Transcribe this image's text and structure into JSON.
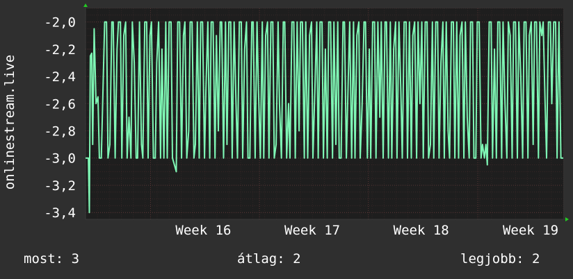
{
  "chart_data": {
    "type": "line",
    "ylabel": "onlinestream.live",
    "xlabel": "",
    "title": "",
    "ylim": [
      -3.45,
      -1.9
    ],
    "yticks": [
      -2.0,
      -2.2,
      -2.4,
      -2.6,
      -2.8,
      -3.0,
      -3.2,
      -3.4
    ],
    "ytick_labels": [
      "-2,0",
      "-2,2",
      "-2,4",
      "-2,6",
      "-2,8",
      "-3,0",
      "-3,2",
      "-3,4"
    ],
    "xlim": [
      0,
      1
    ],
    "xtick_labels": [
      "Week 16",
      "Week 17",
      "Week 18",
      "Week 19"
    ],
    "xticks": [
      0.136,
      0.364,
      0.592,
      0.821
    ],
    "grid": true,
    "colors": {
      "background": "#2f2f2f",
      "plot_background": "#1e1e1e",
      "grid": "#5a3636",
      "line": "#7ff7b5",
      "arrow": "#22cc22"
    },
    "series": [
      {
        "values": [
          [
            0.0,
            -3.0
          ],
          [
            0.006,
            -3.0
          ],
          [
            0.008,
            -3.4
          ],
          [
            0.01,
            -2.25
          ],
          [
            0.013,
            -2.23
          ],
          [
            0.015,
            -2.9
          ],
          [
            0.018,
            -2.05
          ],
          [
            0.022,
            -2.6
          ],
          [
            0.026,
            -2.55
          ],
          [
            0.029,
            -3.0
          ],
          [
            0.033,
            -3.0
          ],
          [
            0.04,
            -2.0
          ],
          [
            0.044,
            -2.0
          ],
          [
            0.047,
            -3.0
          ],
          [
            0.051,
            -2.9
          ],
          [
            0.055,
            -2.0
          ],
          [
            0.058,
            -2.0
          ],
          [
            0.062,
            -3.0
          ],
          [
            0.066,
            -2.2
          ],
          [
            0.069,
            -2.0
          ],
          [
            0.073,
            -2.0
          ],
          [
            0.076,
            -3.0
          ],
          [
            0.08,
            -2.1
          ],
          [
            0.084,
            -2.0
          ],
          [
            0.087,
            -3.0
          ],
          [
            0.091,
            -2.7
          ],
          [
            0.095,
            -3.0
          ],
          [
            0.098,
            -2.0
          ],
          [
            0.102,
            -2.3
          ],
          [
            0.106,
            -3.0
          ],
          [
            0.109,
            -3.0
          ],
          [
            0.113,
            -2.0
          ],
          [
            0.117,
            -2.9
          ],
          [
            0.12,
            -3.0
          ],
          [
            0.124,
            -2.0
          ],
          [
            0.128,
            -2.0
          ],
          [
            0.131,
            -3.0
          ],
          [
            0.135,
            -2.1
          ],
          [
            0.138,
            -2.0
          ],
          [
            0.142,
            -3.0
          ],
          [
            0.146,
            -3.0
          ],
          [
            0.149,
            -2.3
          ],
          [
            0.153,
            -2.0
          ],
          [
            0.157,
            -3.0
          ],
          [
            0.16,
            -2.2
          ],
          [
            0.164,
            -3.0
          ],
          [
            0.168,
            -2.0
          ],
          [
            0.171,
            -3.0
          ],
          [
            0.175,
            -2.0
          ],
          [
            0.179,
            -2.0
          ],
          [
            0.182,
            -3.0
          ],
          [
            0.186,
            -3.05
          ],
          [
            0.19,
            -3.1
          ],
          [
            0.193,
            -2.0
          ],
          [
            0.197,
            -2.0
          ],
          [
            0.201,
            -3.0
          ],
          [
            0.205,
            -2.1
          ],
          [
            0.208,
            -2.0
          ],
          [
            0.212,
            -3.0
          ],
          [
            0.216,
            -2.8
          ],
          [
            0.219,
            -2.0
          ],
          [
            0.223,
            -2.0
          ],
          [
            0.227,
            -3.0
          ],
          [
            0.23,
            -2.9
          ],
          [
            0.234,
            -2.0
          ],
          [
            0.238,
            -3.0
          ],
          [
            0.241,
            -2.0
          ],
          [
            0.245,
            -2.0
          ],
          [
            0.249,
            -3.0
          ],
          [
            0.252,
            -2.5
          ],
          [
            0.256,
            -2.0
          ],
          [
            0.26,
            -3.0
          ],
          [
            0.263,
            -2.0
          ],
          [
            0.267,
            -2.0
          ],
          [
            0.271,
            -3.0
          ],
          [
            0.274,
            -2.1
          ],
          [
            0.278,
            -2.8
          ],
          [
            0.282,
            -2.0
          ],
          [
            0.285,
            -2.0
          ],
          [
            0.289,
            -3.0
          ],
          [
            0.293,
            -2.0
          ],
          [
            0.296,
            -2.9
          ],
          [
            0.3,
            -2.0
          ],
          [
            0.304,
            -2.0
          ],
          [
            0.307,
            -3.0
          ],
          [
            0.311,
            -2.0
          ],
          [
            0.315,
            -2.6
          ],
          [
            0.318,
            -3.0
          ],
          [
            0.322,
            -2.0
          ],
          [
            0.326,
            -2.0
          ],
          [
            0.329,
            -3.0
          ],
          [
            0.333,
            -2.2
          ],
          [
            0.337,
            -2.0
          ],
          [
            0.34,
            -3.0
          ],
          [
            0.344,
            -3.0
          ],
          [
            0.348,
            -2.0
          ],
          [
            0.351,
            -2.0
          ],
          [
            0.355,
            -3.0
          ],
          [
            0.359,
            -2.0
          ],
          [
            0.362,
            -2.5
          ],
          [
            0.366,
            -3.0
          ],
          [
            0.37,
            -2.0
          ],
          [
            0.373,
            -3.0
          ],
          [
            0.377,
            -2.1
          ],
          [
            0.381,
            -2.0
          ],
          [
            0.384,
            -3.0
          ],
          [
            0.388,
            -2.0
          ],
          [
            0.392,
            -2.0
          ],
          [
            0.395,
            -3.0
          ],
          [
            0.399,
            -2.9
          ],
          [
            0.403,
            -2.0
          ],
          [
            0.406,
            -2.6
          ],
          [
            0.41,
            -3.0
          ],
          [
            0.414,
            -2.0
          ],
          [
            0.417,
            -2.0
          ],
          [
            0.421,
            -3.0
          ],
          [
            0.425,
            -2.6
          ],
          [
            0.428,
            -3.0
          ],
          [
            0.432,
            -2.0
          ],
          [
            0.436,
            -2.0
          ],
          [
            0.439,
            -3.0
          ],
          [
            0.443,
            -2.0
          ],
          [
            0.447,
            -2.8
          ],
          [
            0.45,
            -2.0
          ],
          [
            0.454,
            -2.0
          ],
          [
            0.458,
            -3.0
          ],
          [
            0.461,
            -2.0
          ],
          [
            0.465,
            -3.0
          ],
          [
            0.469,
            -2.1
          ],
          [
            0.473,
            -2.0
          ],
          [
            0.476,
            -3.0
          ],
          [
            0.48,
            -2.5
          ],
          [
            0.484,
            -2.0
          ],
          [
            0.487,
            -3.0
          ],
          [
            0.491,
            -2.0
          ],
          [
            0.495,
            -2.0
          ],
          [
            0.498,
            -3.0
          ],
          [
            0.502,
            -2.2
          ],
          [
            0.506,
            -3.0
          ],
          [
            0.509,
            -2.0
          ],
          [
            0.513,
            -2.0
          ],
          [
            0.517,
            -3.0
          ],
          [
            0.52,
            -2.0
          ],
          [
            0.524,
            -2.9
          ],
          [
            0.528,
            -2.0
          ],
          [
            0.531,
            -3.0
          ],
          [
            0.535,
            -3.0
          ],
          [
            0.539,
            -2.0
          ],
          [
            0.542,
            -2.0
          ],
          [
            0.546,
            -3.0
          ],
          [
            0.55,
            -2.4
          ],
          [
            0.553,
            -2.0
          ],
          [
            0.557,
            -3.0
          ],
          [
            0.561,
            -2.0
          ],
          [
            0.564,
            -3.0
          ],
          [
            0.568,
            -2.1
          ],
          [
            0.572,
            -2.0
          ],
          [
            0.575,
            -3.0
          ],
          [
            0.579,
            -2.6
          ],
          [
            0.583,
            -2.0
          ],
          [
            0.586,
            -2.0
          ],
          [
            0.59,
            -3.0
          ],
          [
            0.594,
            -2.2
          ],
          [
            0.597,
            -3.0
          ],
          [
            0.601,
            -2.0
          ],
          [
            0.605,
            -2.0
          ],
          [
            0.608,
            -3.0
          ],
          [
            0.612,
            -2.0
          ],
          [
            0.616,
            -2.7
          ],
          [
            0.619,
            -2.0
          ],
          [
            0.623,
            -3.0
          ],
          [
            0.627,
            -2.0
          ],
          [
            0.63,
            -2.0
          ],
          [
            0.634,
            -3.0
          ],
          [
            0.638,
            -2.0
          ],
          [
            0.641,
            -3.0
          ],
          [
            0.645,
            -2.2
          ],
          [
            0.649,
            -2.0
          ],
          [
            0.652,
            -3.0
          ],
          [
            0.656,
            -2.0
          ],
          [
            0.66,
            -2.5
          ],
          [
            0.663,
            -3.0
          ],
          [
            0.667,
            -2.0
          ],
          [
            0.671,
            -2.0
          ],
          [
            0.674,
            -3.0
          ],
          [
            0.678,
            -2.0
          ],
          [
            0.682,
            -3.0
          ],
          [
            0.685,
            -2.1
          ],
          [
            0.689,
            -2.0
          ],
          [
            0.693,
            -3.0
          ],
          [
            0.696,
            -2.0
          ],
          [
            0.7,
            -2.6
          ],
          [
            0.704,
            -2.0
          ],
          [
            0.707,
            -3.0
          ],
          [
            0.711,
            -2.0
          ],
          [
            0.715,
            -2.0
          ],
          [
            0.718,
            -3.0
          ],
          [
            0.722,
            -2.9
          ],
          [
            0.726,
            -2.0
          ],
          [
            0.729,
            -3.0
          ],
          [
            0.733,
            -2.0
          ],
          [
            0.737,
            -2.0
          ],
          [
            0.74,
            -3.0
          ],
          [
            0.744,
            -2.3
          ],
          [
            0.748,
            -2.0
          ],
          [
            0.751,
            -3.0
          ],
          [
            0.755,
            -2.0
          ],
          [
            0.759,
            -2.8
          ],
          [
            0.762,
            -3.0
          ],
          [
            0.766,
            -2.0
          ],
          [
            0.77,
            -2.0
          ],
          [
            0.773,
            -3.0
          ],
          [
            0.777,
            -2.0
          ],
          [
            0.781,
            -3.0
          ],
          [
            0.784,
            -2.1
          ],
          [
            0.788,
            -2.0
          ],
          [
            0.792,
            -3.0
          ],
          [
            0.795,
            -2.0
          ],
          [
            0.799,
            -2.7
          ],
          [
            0.803,
            -3.0
          ],
          [
            0.806,
            -2.0
          ],
          [
            0.81,
            -2.0
          ],
          [
            0.813,
            -3.0
          ],
          [
            0.817,
            -3.0
          ],
          [
            0.82,
            -2.0
          ],
          [
            0.824,
            -2.0
          ],
          [
            0.828,
            -3.0
          ],
          [
            0.831,
            -2.9
          ],
          [
            0.835,
            -3.0
          ],
          [
            0.838,
            -2.9
          ],
          [
            0.841,
            -3.05
          ],
          [
            0.845,
            -2.0
          ],
          [
            0.849,
            -2.0
          ],
          [
            0.852,
            -3.0
          ],
          [
            0.856,
            -2.2
          ],
          [
            0.86,
            -3.0
          ],
          [
            0.863,
            -2.0
          ],
          [
            0.867,
            -2.0
          ],
          [
            0.871,
            -3.0
          ],
          [
            0.874,
            -2.0
          ],
          [
            0.878,
            -2.6
          ],
          [
            0.882,
            -3.0
          ],
          [
            0.885,
            -2.0
          ],
          [
            0.889,
            -2.1
          ],
          [
            0.893,
            -3.0
          ],
          [
            0.896,
            -2.0
          ],
          [
            0.9,
            -2.0
          ],
          [
            0.904,
            -3.0
          ],
          [
            0.907,
            -2.0
          ],
          [
            0.911,
            -2.4
          ],
          [
            0.915,
            -3.0
          ],
          [
            0.918,
            -2.0
          ],
          [
            0.922,
            -2.0
          ],
          [
            0.926,
            -3.0
          ],
          [
            0.929,
            -2.1
          ],
          [
            0.933,
            -2.0
          ],
          [
            0.937,
            -2.9
          ],
          [
            0.94,
            -2.0
          ],
          [
            0.944,
            -2.0
          ],
          [
            0.948,
            -3.0
          ],
          [
            0.951,
            -2.0
          ],
          [
            0.955,
            -2.1
          ],
          [
            0.958,
            -2.0
          ],
          [
            0.962,
            -2.6
          ],
          [
            0.965,
            -3.0
          ],
          [
            0.969,
            -2.0
          ],
          [
            0.973,
            -2.0
          ],
          [
            0.976,
            -2.6
          ],
          [
            0.98,
            -2.0
          ],
          [
            0.984,
            -2.0
          ],
          [
            0.987,
            -3.0
          ],
          [
            0.991,
            -2.0
          ],
          [
            0.995,
            -3.0
          ],
          [
            1.0,
            -3.0
          ]
        ]
      }
    ]
  },
  "legend": {
    "most": "most: 3",
    "atlag": "átlag: 2",
    "legjobb": "legjobb: 2"
  }
}
